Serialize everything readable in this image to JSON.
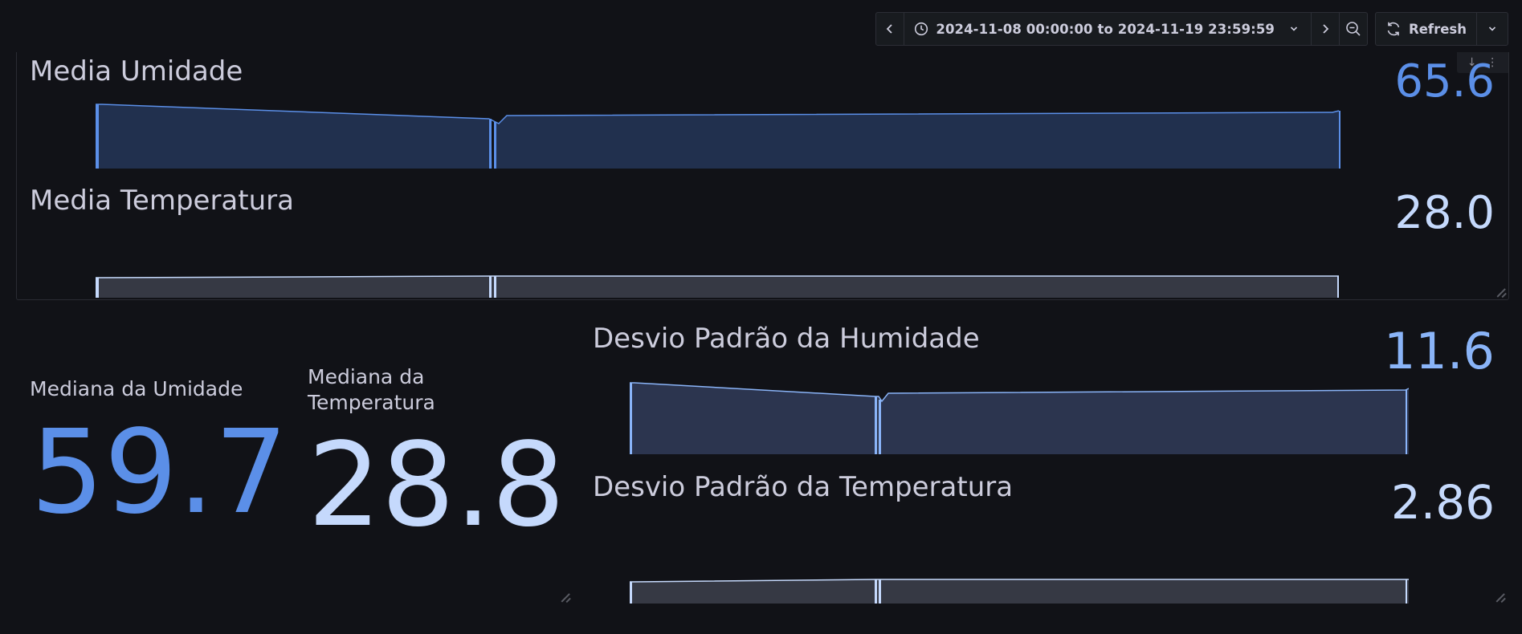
{
  "toolbar": {
    "prev_icon": "chevron-left-icon",
    "time_range": "2024-11-08 00:00:00 to 2024-11-19 23:59:59",
    "clock_icon": "clock-icon",
    "next_icon": "chevron-right-icon",
    "zoom_icon": "zoom-out-icon",
    "refresh_label": "Refresh",
    "refresh_icon": "refresh-icon"
  },
  "colors": {
    "background": "#111217",
    "blue": "#5b8fe8",
    "light_blue": "#c5d9fc",
    "mid_blue": "#8ab4f8",
    "text": "#ccccdc"
  },
  "panels": {
    "media_umidade": {
      "title": "Media Umidade",
      "value": "65.6"
    },
    "media_temperatura": {
      "title": "Media Temperatura",
      "value": "28.0"
    },
    "mediana_umidade": {
      "title": "Mediana da Umidade",
      "value": "59.7"
    },
    "mediana_temperatura": {
      "title": "Mediana da Temperatura",
      "value": "28.8"
    },
    "desvio_humidade": {
      "title": "Desvio Padrão da Humidade",
      "value": "11.6"
    },
    "desvio_temperatura": {
      "title": "Desvio Padrão da Temperatura",
      "value": "2.86"
    }
  }
}
